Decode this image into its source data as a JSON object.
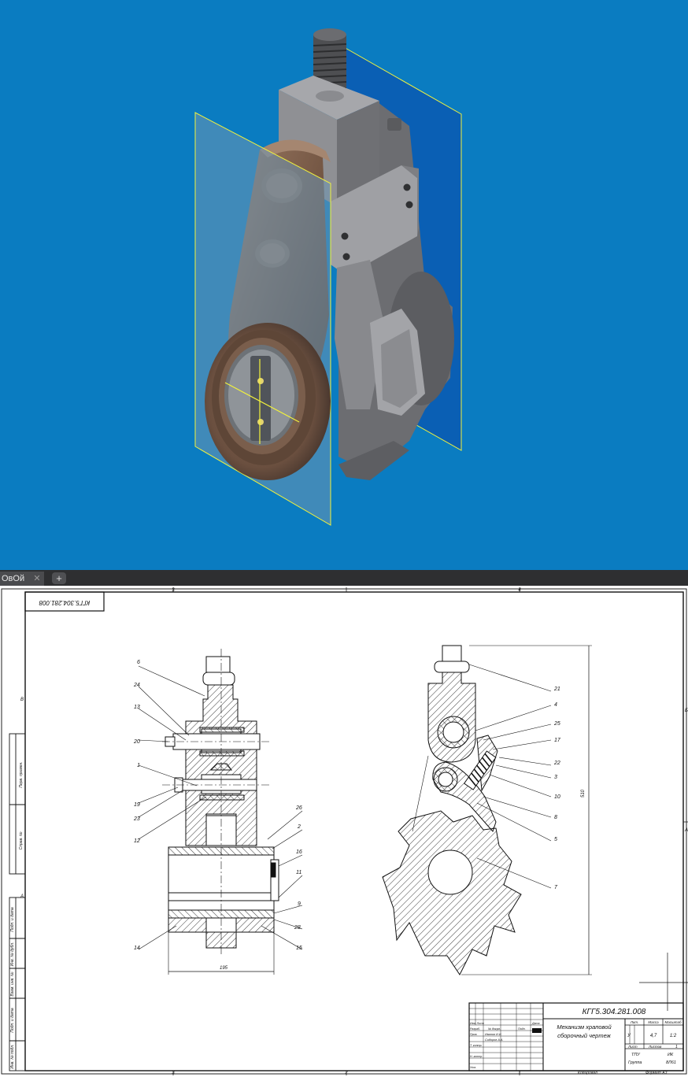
{
  "tabs": [
    {
      "label": "ОвОй",
      "close_icon": "close-icon"
    },
    {
      "add_icon": "plus-icon"
    }
  ],
  "colors": {
    "viewport_bg": "#0a7cc1",
    "plane_back": "#0a5fb4",
    "plane_front": "#5f8fb0",
    "plane_edge": "#f2f23c",
    "steel": "#9a9b9f",
    "bronze": "#7a5a45"
  },
  "drawing": {
    "doc_code_rotated": "КГГ5.304.281.008",
    "frame_zone_marks": {
      "top": [
        "3",
        "4"
      ],
      "bottom": [
        "3",
        "2",
        "1"
      ],
      "left": [
        "В",
        "А"
      ],
      "right": [
        "Б",
        "А"
      ]
    },
    "left_strip": [
      "Перв. примен.",
      "Справ. №",
      "Подп. и дата",
      "Инв. № дубл.",
      "Взам. инв. №",
      "Подп. и дата",
      "Инв. № подл."
    ],
    "left_view_callouts": [
      "6",
      "24",
      "13",
      "20",
      "1",
      "19",
      "23",
      "12",
      "26",
      "2",
      "16",
      "11",
      "9",
      "28",
      "15",
      "14"
    ],
    "right_view_callouts": [
      "21",
      "4",
      "25",
      "17",
      "22",
      "3",
      "10",
      "8",
      "5",
      "7"
    ],
    "dim_width": "195",
    "dim_height": "510",
    "title_block": {
      "doc_code": "КГГ5.304.281.008",
      "name_line1": "Механизм храповой",
      "name_line2": "сборочный чертеж",
      "col_lit": "Лит.",
      "col_mass": "Масса",
      "col_scale": "Масштаб",
      "lit_value": "У",
      "mass_value": "4,7",
      "scale_value": "1:2",
      "sheet_label": "Лист",
      "sheets_label": "Листов",
      "sheets_value": "1",
      "org1": "ТПУ",
      "org2": "ИК",
      "group_label": "Группа",
      "group_value": "8Л61",
      "roles": [
        "Изм. Лист",
        "Разраб.",
        "Пров.",
        "Т. контр.",
        "Н. контр.",
        "Утв."
      ],
      "doc_no_label": "№ докум.",
      "sign_label": "Подп.",
      "date_label": "Дата",
      "developer": "Иванов И.И.",
      "checker": "Сидоров А.А."
    },
    "bottom_labels": {
      "copied": "Копировал",
      "format": "Формат А3"
    }
  }
}
